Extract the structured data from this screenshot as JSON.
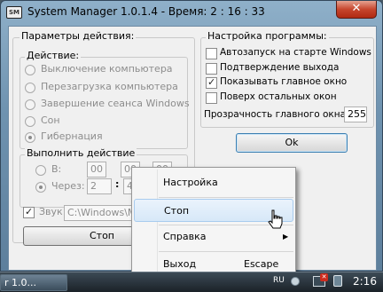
{
  "window": {
    "icon_text": "SM",
    "title": "System Manager 1.0.1.4 - Время: 2 : 16 : 33",
    "close_glyph": "✕"
  },
  "action_params": {
    "legend": "Параметры действия:",
    "action_group": {
      "legend": "Действие:",
      "options": [
        {
          "label": "Выключение компьютера",
          "selected": false
        },
        {
          "label": "Перезагрузка компьютера",
          "selected": false
        },
        {
          "label": "Завершение сеанса Windows",
          "selected": false
        },
        {
          "label": "Сон",
          "selected": false
        },
        {
          "label": "Гибернация",
          "selected": true
        }
      ]
    },
    "execute_group": {
      "legend": "Выполнить действие",
      "at_label": "В:",
      "at_hours": "00",
      "at_minutes": "00",
      "at_seconds": "00",
      "in_label": "Через:",
      "in_hours": "2",
      "in_minutes": "45",
      "separator": ":"
    },
    "sound_label": "Звук:",
    "sound_path": "C:\\Windows\\Me",
    "sound_checked": true,
    "stop_button": "Стоп"
  },
  "program_settings": {
    "legend": "Настройка программы:",
    "options": [
      {
        "label": "Автозапуск на старте Windows",
        "checked": false
      },
      {
        "label": "Подтверждение выхода",
        "checked": false
      },
      {
        "label": "Показывать главное окно",
        "checked": true
      },
      {
        "label": "Поверх остальных окон",
        "checked": false
      }
    ],
    "opacity_label": "Прозрачность главного окна:",
    "opacity_value": "255",
    "ok_button": "Ok"
  },
  "context_menu": {
    "items": [
      {
        "label": "Настройка",
        "shortcut": "",
        "submenu": false,
        "highlighted": false
      },
      {
        "label": "Стоп",
        "shortcut": "",
        "submenu": false,
        "highlighted": true
      },
      {
        "label": "Справка",
        "shortcut": "",
        "submenu": true,
        "highlighted": false
      },
      {
        "label": "Выход",
        "shortcut": "Escape",
        "submenu": false,
        "highlighted": false
      }
    ]
  },
  "taskbar": {
    "task_label": "r 1.0...",
    "language": "RU",
    "clock": "2:16"
  },
  "colors": {
    "title_bar": "#7a9bb6",
    "close_button": "#c6462d",
    "menu_highlight": "#d7e8f8"
  }
}
